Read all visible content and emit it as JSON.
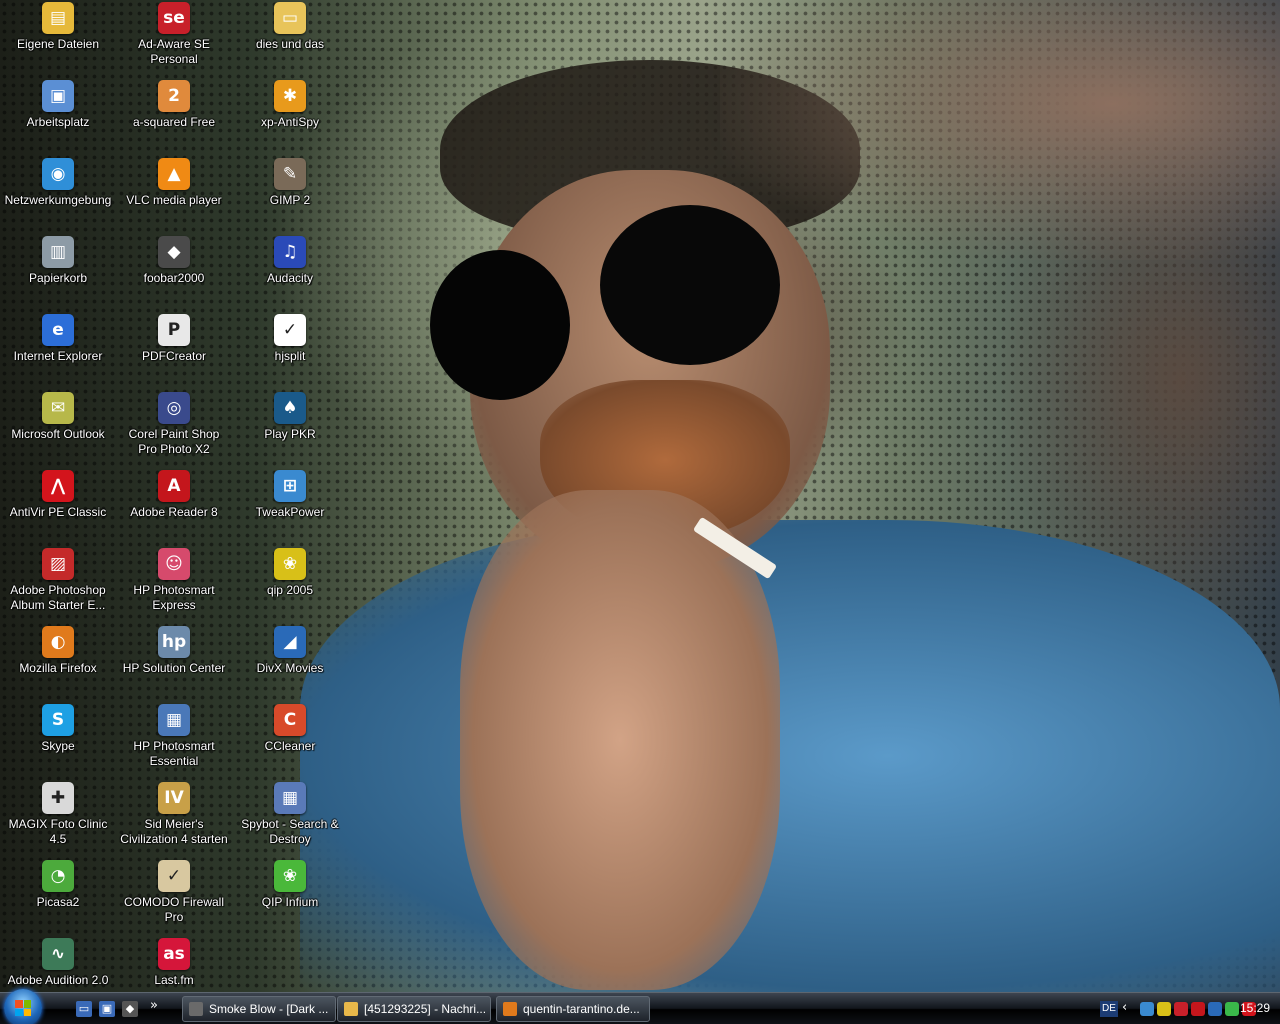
{
  "desktop": {
    "icons": [
      {
        "label": "Eigene Dateien",
        "color": "#e6b93a",
        "glyph": "▤"
      },
      {
        "label": "Arbeitsplatz",
        "color": "#5b8fd4",
        "glyph": "▣"
      },
      {
        "label": "Netzwerkumgebung",
        "color": "#2f8fd8",
        "glyph": "◉"
      },
      {
        "label": "Papierkorb",
        "color": "#8d9ba6",
        "glyph": "▥"
      },
      {
        "label": "Internet Explorer",
        "color": "#2c6ed8",
        "glyph": "e"
      },
      {
        "label": "Microsoft Outlook",
        "color": "#b7b84a",
        "glyph": "✉"
      },
      {
        "label": "AntiVir PE Classic",
        "color": "#d3141c",
        "glyph": "⋀"
      },
      {
        "label": "Adobe Photoshop Album Starter E...",
        "color": "#c42a2a",
        "glyph": "▨"
      },
      {
        "label": "Mozilla Firefox",
        "color": "#e07a1c",
        "glyph": "◐"
      },
      {
        "label": "Skype",
        "color": "#1ea0e4",
        "glyph": "S"
      },
      {
        "label": "MAGIX Foto Clinic 4.5",
        "color": "#d9d9d9",
        "glyph": "✚"
      },
      {
        "label": "Picasa2",
        "color": "#4caa3c",
        "glyph": "◔"
      },
      {
        "label": "Adobe Audition 2.0",
        "color": "#3d7a58",
        "glyph": "∿"
      },
      {
        "label": "Ad-Aware SE Personal",
        "color": "#c8202a",
        "glyph": "se"
      },
      {
        "label": "a-squared Free",
        "color": "#e08a3c",
        "glyph": "2"
      },
      {
        "label": "VLC media player",
        "color": "#f08a14",
        "glyph": "▲"
      },
      {
        "label": "foobar2000",
        "color": "#4a4a4a",
        "glyph": "◆"
      },
      {
        "label": "PDFCreator",
        "color": "#e8e8e8",
        "glyph": "P"
      },
      {
        "label": "Corel Paint Shop Pro Photo X2",
        "color": "#3a4a8c",
        "glyph": "◎"
      },
      {
        "label": "Adobe Reader 8",
        "color": "#c4161c",
        "glyph": "A"
      },
      {
        "label": "HP Photosmart Express",
        "color": "#d64a6c",
        "glyph": "☺"
      },
      {
        "label": "HP Solution Center",
        "color": "#6c8aaa",
        "glyph": "hp"
      },
      {
        "label": "HP Photosmart Essential",
        "color": "#4a78b8",
        "glyph": "▦"
      },
      {
        "label": "Sid Meier's Civilization 4 starten",
        "color": "#c8a048",
        "glyph": "IV"
      },
      {
        "label": "COMODO Firewall Pro",
        "color": "#d8c8a0",
        "glyph": "✓"
      },
      {
        "label": "Last.fm",
        "color": "#d5163a",
        "glyph": "as"
      },
      {
        "label": "dies und das",
        "color": "#e8c45a",
        "glyph": "▭"
      },
      {
        "label": "xp-AntiSpy",
        "color": "#e89a1c",
        "glyph": "✱"
      },
      {
        "label": "GIMP 2",
        "color": "#7a6a58",
        "glyph": "✎"
      },
      {
        "label": "Audacity",
        "color": "#2a4ab8",
        "glyph": "♫"
      },
      {
        "label": "hjsplit",
        "color": "#ffffff",
        "glyph": "✓"
      },
      {
        "label": "Play PKR",
        "color": "#1a5a8a",
        "glyph": "♠"
      },
      {
        "label": "TweakPower",
        "color": "#3a8ad0",
        "glyph": "⊞"
      },
      {
        "label": "qip 2005",
        "color": "#d8c018",
        "glyph": "❀"
      },
      {
        "label": "DivX Movies",
        "color": "#2a6ab8",
        "glyph": "◢"
      },
      {
        "label": "CCleaner",
        "color": "#d84a2a",
        "glyph": "C"
      },
      {
        "label": "Spybot - Search & Destroy",
        "color": "#5a7ab8",
        "glyph": "▦"
      },
      {
        "label": "QIP Infium",
        "color": "#4ab83a",
        "glyph": "❀"
      }
    ]
  },
  "taskbar": {
    "quick_launch": [
      {
        "name": "show-desktop-icon",
        "glyph": "▭",
        "color": "#3a6ab8"
      },
      {
        "name": "switch-windows-icon",
        "glyph": "▣",
        "color": "#3a6ab8"
      },
      {
        "name": "foobar-quicklaunch-icon",
        "glyph": "◆",
        "color": "#555555"
      }
    ],
    "chevron": "»",
    "tasks": [
      {
        "label": "Smoke Blow - [Dark ...",
        "color": "#6a6a6a"
      },
      {
        "label": "[451293225] - Nachri...",
        "color": "#e8b84a"
      },
      {
        "label": "quentin-tarantino.de...",
        "color": "#e07a1c"
      }
    ],
    "tray": {
      "language": "DE",
      "arrow": "‹",
      "clock": "15:29",
      "icons": [
        "#3a8ad0",
        "#d8c018",
        "#c8202a",
        "#c4161c",
        "#2a6ab8",
        "#3ab84a",
        "#d3141c"
      ]
    }
  }
}
